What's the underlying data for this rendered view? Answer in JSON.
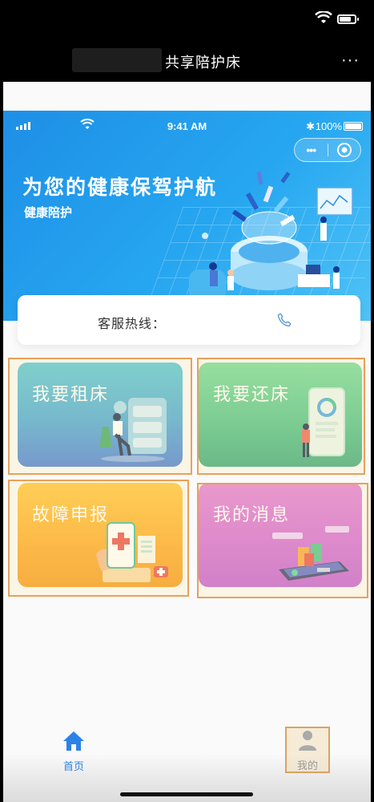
{
  "navbar": {
    "title": "共享陪护床",
    "more_label": "···"
  },
  "inner_status": {
    "time": "9:41 AM",
    "battery": "100%",
    "bluetooth": "✱"
  },
  "capsule": {
    "dots": "•••"
  },
  "banner": {
    "slogan": "为您的健康保驾护航",
    "subtitle": "健康陪护"
  },
  "hotline": {
    "label": "客服热线："
  },
  "cards": [
    {
      "id": "rent",
      "title": "我要租床"
    },
    {
      "id": "return",
      "title": "我要还床"
    },
    {
      "id": "fault",
      "title": "故障申报"
    },
    {
      "id": "message",
      "title": "我的消息"
    }
  ],
  "tabbar": {
    "items": [
      {
        "label": "首页",
        "active": true
      },
      {
        "label": "我的",
        "active": false
      }
    ]
  },
  "colors": {
    "banner": "#26a6f0",
    "rent": "#4aa9d8",
    "return": "#4fc28a",
    "fault": "#fcac28",
    "message": "#d36bd7",
    "tab_active": "#2c82e6"
  }
}
